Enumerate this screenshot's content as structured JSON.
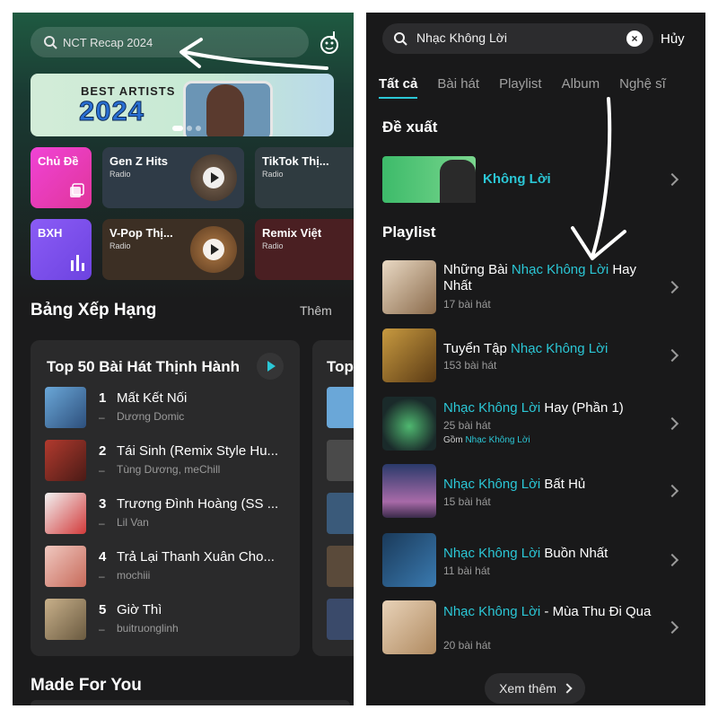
{
  "left": {
    "search_placeholder": "NCT Recap 2024",
    "banner": {
      "line1": "BEST ARTISTS",
      "line2": "2024"
    },
    "tiles": [
      {
        "title": "Chủ Đề",
        "sub": ""
      },
      {
        "title": "Gen Z Hits",
        "sub": "Radio"
      },
      {
        "title": "TikTok Thị...",
        "sub": "Radio"
      },
      {
        "title": "BXH",
        "sub": ""
      },
      {
        "title": "V-Pop Thị...",
        "sub": "Radio"
      },
      {
        "title": "Remix Việt",
        "sub": "Radio"
      }
    ],
    "chart_section_title": "Bảng Xếp Hạng",
    "chart_more": "Thêm",
    "card_title": "Top 50 Bài Hát Thịnh Hành",
    "card2_title": "Top",
    "songs": [
      {
        "rank": "1",
        "name": "Mất Kết Nối",
        "artist": "Dương Domic"
      },
      {
        "rank": "2",
        "name": "Tái Sinh (Remix Style Hu...",
        "artist": "Tùng Dương, meChill"
      },
      {
        "rank": "3",
        "name": "Trương Đình Hoàng (SS ...",
        "artist": "Lil Van"
      },
      {
        "rank": "4",
        "name": "Trả Lại Thanh Xuân Cho...",
        "artist": "mochiii"
      },
      {
        "rank": "5",
        "name": "Giờ Thì",
        "artist": "buitruonglinh"
      }
    ],
    "made_for_you": "Made For You"
  },
  "right": {
    "search_value": "Nhạc Không Lời",
    "cancel": "Hủy",
    "tabs": [
      "Tất cả",
      "Bài hát",
      "Playlist",
      "Album",
      "Nghệ sĩ"
    ],
    "suggest_title": "Đề xuất",
    "suggest_item": "Không Lời",
    "playlist_title": "Playlist",
    "playlists": [
      {
        "pre": "Những Bài ",
        "hl": "Nhạc Không Lời",
        "post": " Hay Nhất",
        "count": "17 bài hát",
        "extra": ""
      },
      {
        "pre": "Tuyển Tập ",
        "hl": "Nhạc Không Lời",
        "post": "",
        "count": "153 bài hát",
        "extra": ""
      },
      {
        "pre": "",
        "hl": "Nhạc Không Lời",
        "post": " Hay (Phần 1)",
        "count": "25 bài hát",
        "extra_pre": "Gồm ",
        "extra": "Nhạc Không Lời"
      },
      {
        "pre": "",
        "hl": "Nhạc Không Lời",
        "post": " Bất Hủ",
        "count": "15 bài hát",
        "extra": ""
      },
      {
        "pre": "",
        "hl": "Nhạc Không Lời",
        "post": " Buồn Nhất",
        "count": "11 bài hát",
        "extra": ""
      },
      {
        "pre": "",
        "hl": "Nhạc Không Lời",
        "post": " - Mùa Thu Đi Qua",
        "count": "20 bài hát",
        "extra": ""
      }
    ],
    "see_more": "Xem thêm"
  },
  "colors": {
    "accent": "#2bc7d6",
    "panel_bg": "#19191a"
  }
}
